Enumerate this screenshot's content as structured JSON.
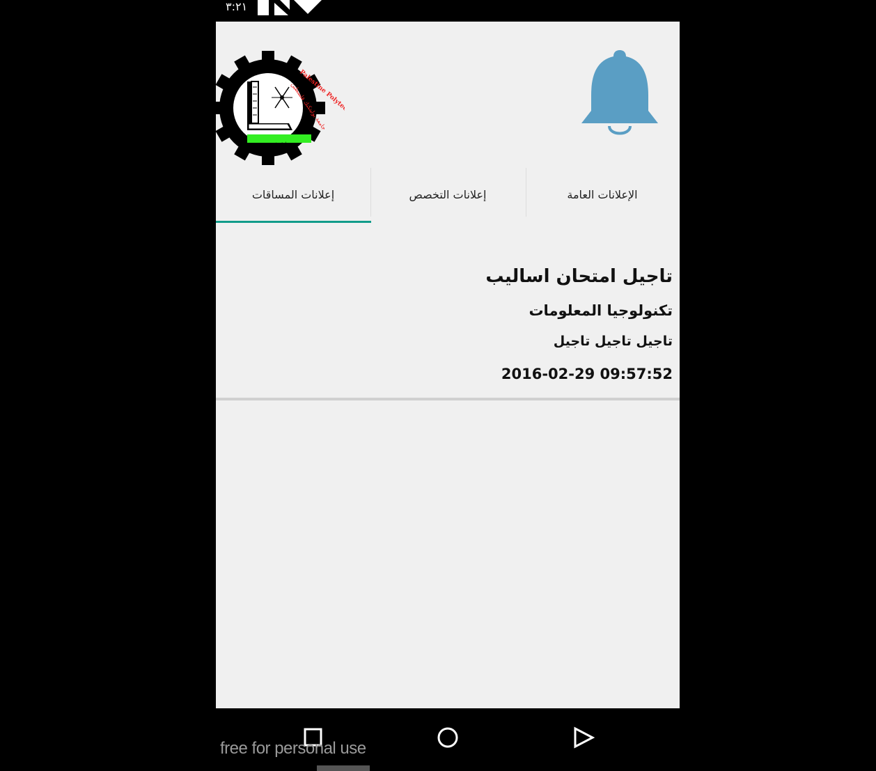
{
  "status_bar": {
    "time": "٣:٢١"
  },
  "logo": {
    "en_text": "Palestine Polytechnic University",
    "ar_text": "جامعة بوليتكنك فلسطين",
    "motto": "ريادة، تخصص، تميز"
  },
  "header": {
    "bell_color": "#5a9ec4"
  },
  "tabs": [
    {
      "label": "الإعلانات العامة",
      "selected": false
    },
    {
      "label": "إعلانات التخصص",
      "selected": false
    },
    {
      "label": "إعلانات المساقات",
      "selected": true
    }
  ],
  "announcement": {
    "title": "تاجيل امتحان اساليب",
    "department": "تكنولوجيا المعلومات",
    "body": "تاجيل تاجيل تاجيل",
    "datetime": "2016-02-29 09:57:52"
  },
  "nav_bar": {
    "watermark": "free for personal use",
    "recent_icon": "square-icon",
    "home_icon": "circle-icon",
    "back_icon": "triangle-icon"
  },
  "colors": {
    "accent": "#119c8a",
    "screen_bg": "#f0f0f0"
  }
}
